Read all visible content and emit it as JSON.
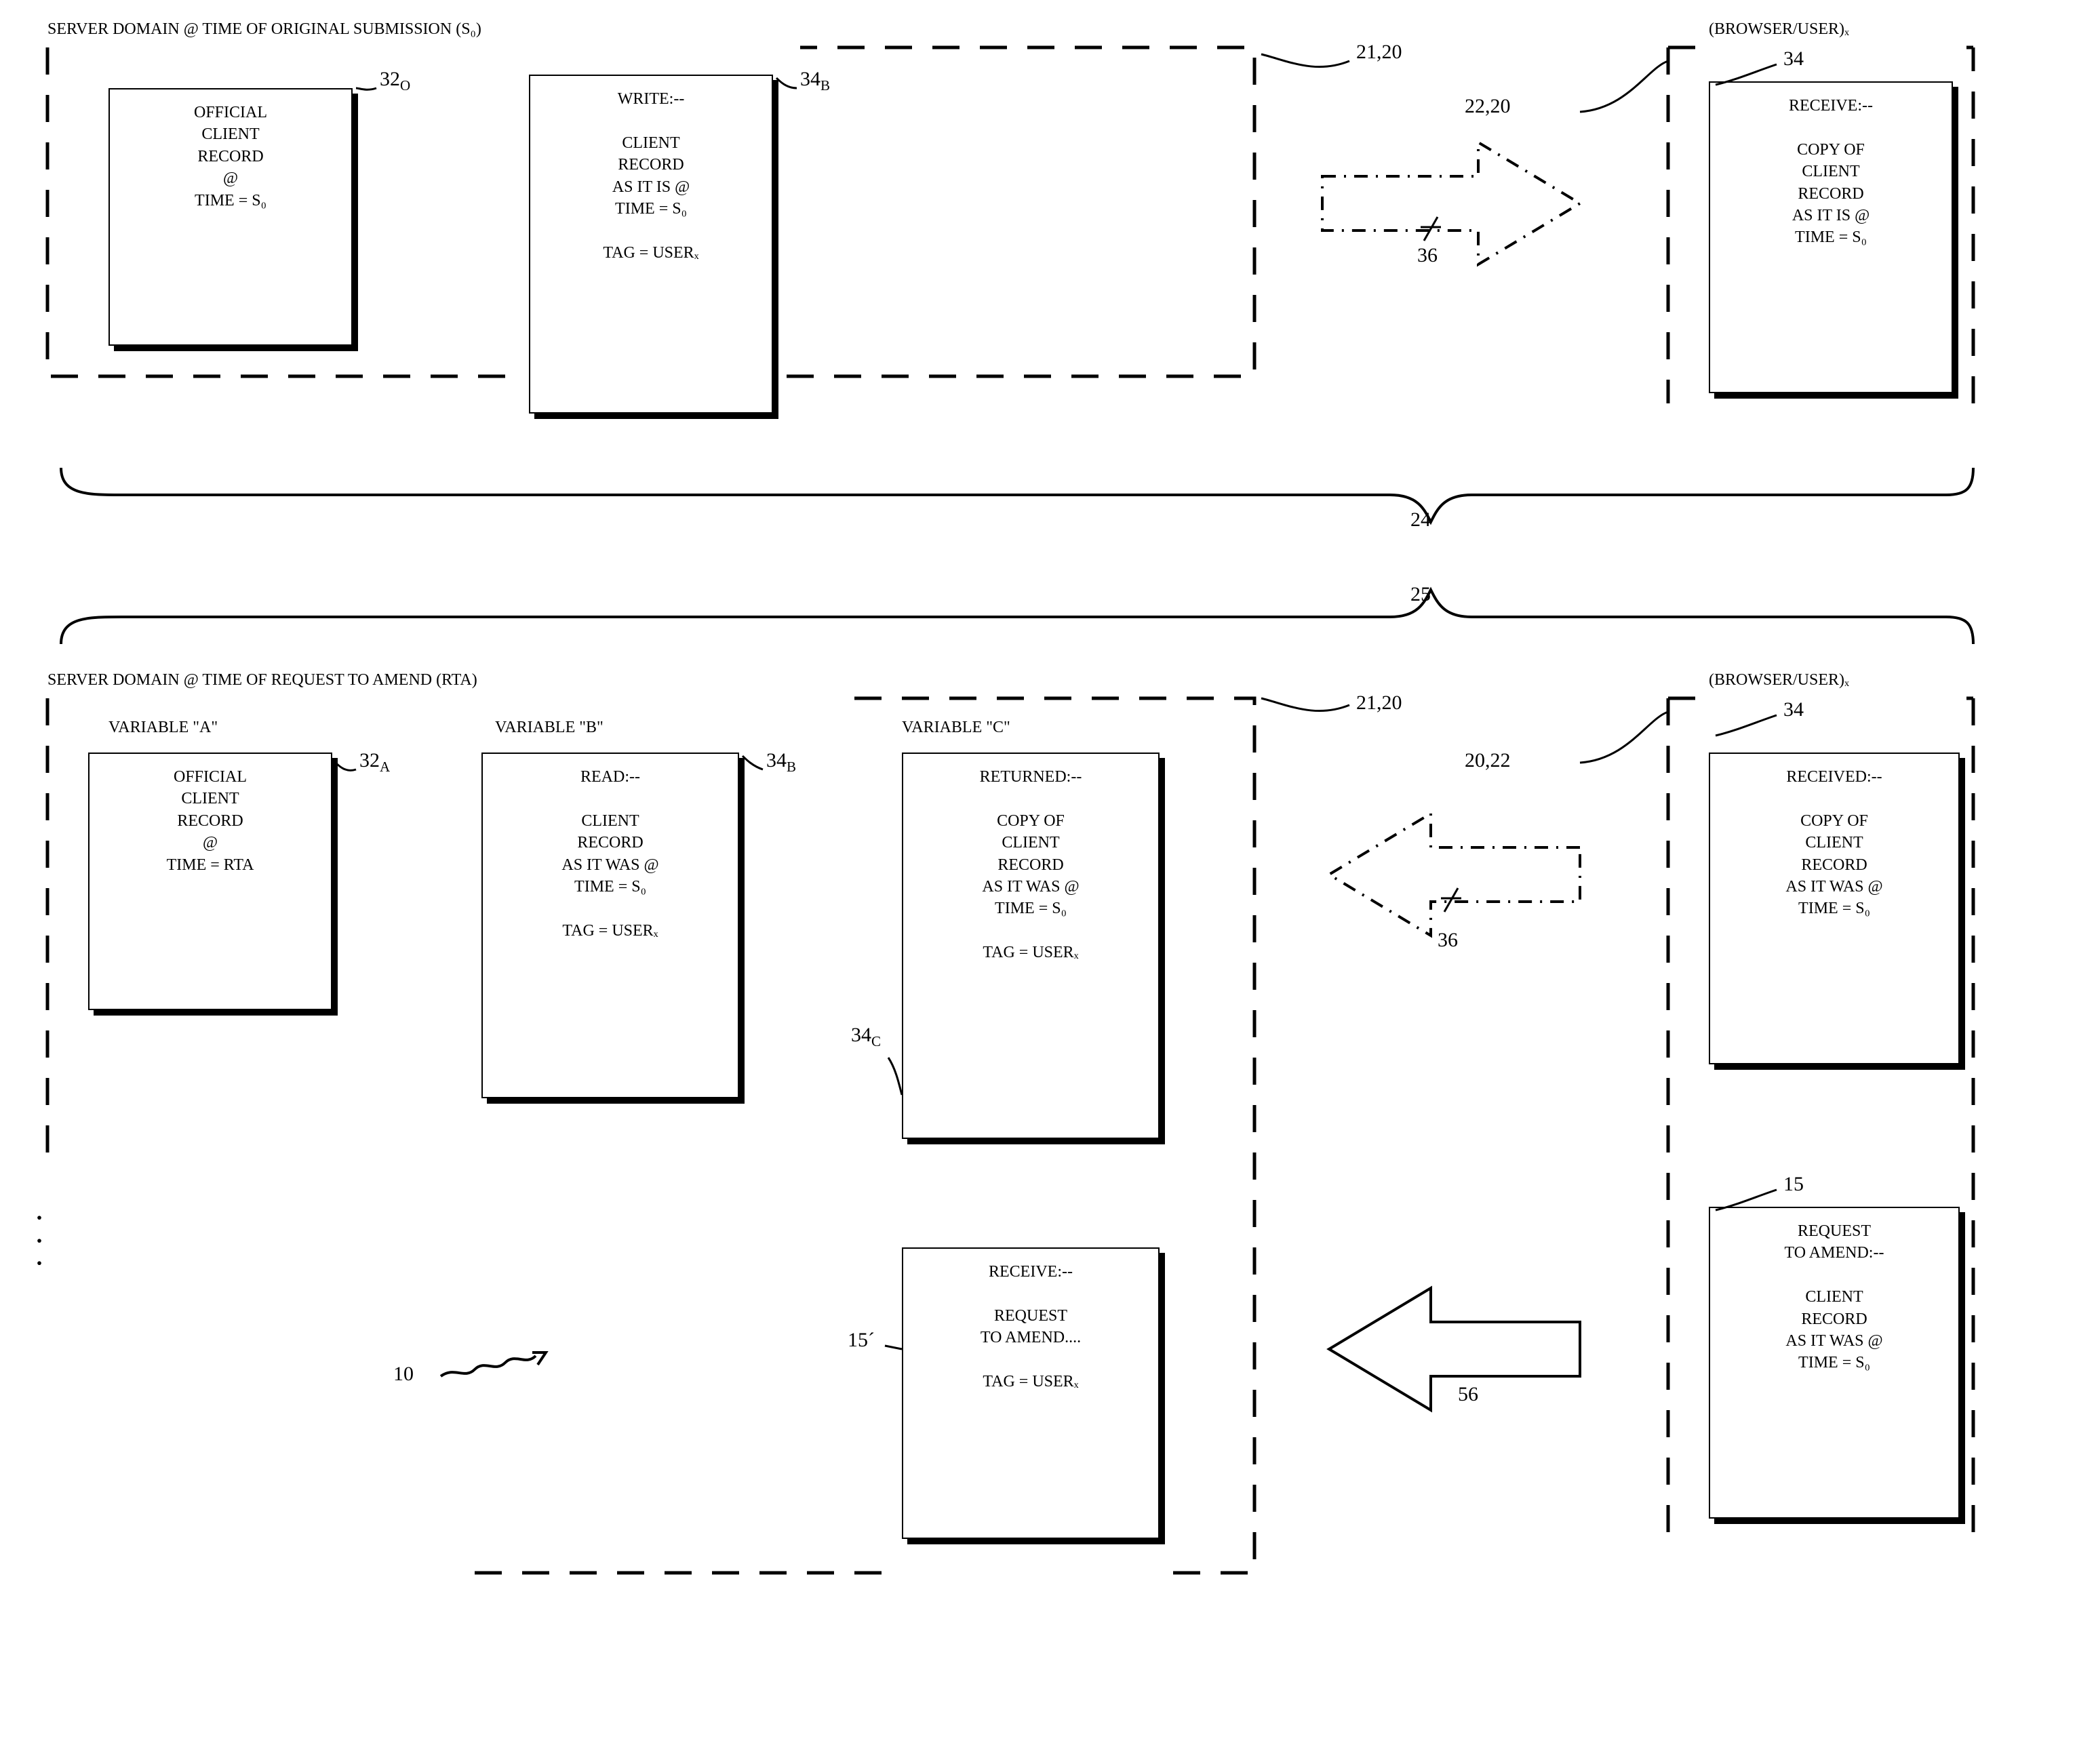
{
  "top": {
    "title": "SERVER DOMAIN @ TIME OF ORIGINAL SUBMISSION (S₀)",
    "browser_label": "(BROWSER/USER)ₓ",
    "box1": "OFFICIAL\nCLIENT\nRECORD\n@\nTIME = S₀",
    "box2": "WRITE:--\n\nCLIENT\nRECORD\nAS IT IS @\nTIME = S₀\n\nTAG = USERₓ",
    "box3": "RECEIVE:--\n\nCOPY OF\nCLIENT\nRECORD\nAS IT IS @\nTIME = S₀"
  },
  "bottom": {
    "title": "SERVER DOMAIN @ TIME OF REQUEST TO AMEND (RTA)",
    "browser_label": "(BROWSER/USER)ₓ",
    "varA": "VARIABLE \"A\"",
    "varB": "VARIABLE \"B\"",
    "varC": "VARIABLE \"C\"",
    "boxA": "OFFICIAL\nCLIENT\nRECORD\n@\nTIME = RTA",
    "boxB": "READ:--\n\nCLIENT\nRECORD\nAS IT WAS @\nTIME = S₀\n\nTAG = USERₓ",
    "boxC": "RETURNED:--\n\nCOPY OF\nCLIENT\nRECORD\nAS IT WAS @\nTIME = S₀\n\nTAG = USERₓ",
    "boxBrowser1": "RECEIVED:--\n\nCOPY OF\nCLIENT\nRECORD\nAS IT WAS @\nTIME = S₀",
    "boxBrowser2": "REQUEST\nTO AMEND:--\n\nCLIENT\nRECORD\nAS IT WAS @\nTIME = S₀",
    "boxReceive": "RECEIVE:--\n\nREQUEST\nTO AMEND....\n\nTAG = USERₓ"
  },
  "ref": {
    "r21_20_top": "21,20",
    "r22_20_top": "22,20",
    "r34_top": "34",
    "r32o": "32ₒ",
    "r34b_top": "34_B",
    "r36_top": "36",
    "r24": "24",
    "r25": "25",
    "r21_20_bot": "21,20",
    "r20_22_bot": "20,22",
    "r34_bot": "34",
    "r32a": "32_A",
    "r34b_bot": "34_B",
    "r34c": "34_C",
    "r36_bot": "36",
    "r15": "15",
    "r15p": "15",
    "r56": "56",
    "r10": "10"
  }
}
